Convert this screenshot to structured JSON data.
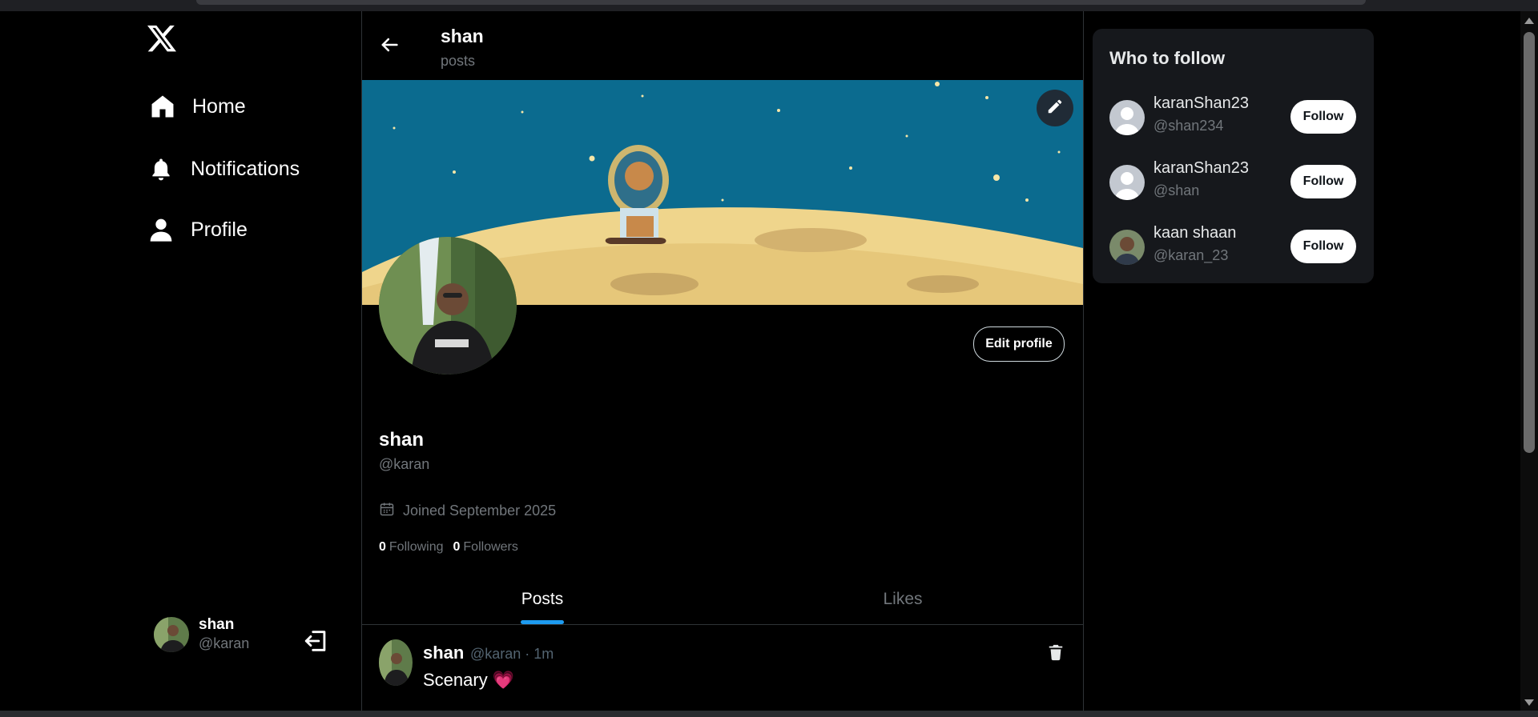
{
  "sidebar": {
    "nav": [
      {
        "label": "Home",
        "icon": "home-icon"
      },
      {
        "label": "Notifications",
        "icon": "bell-icon"
      },
      {
        "label": "Profile",
        "icon": "user-icon"
      }
    ],
    "account": {
      "name": "shan",
      "handle": "@karan"
    }
  },
  "header": {
    "name": "shan",
    "subtitle": "posts"
  },
  "profile": {
    "name": "shan",
    "handle": "@karan",
    "joined": "Joined September 2025",
    "following_count": "0",
    "following_label": "Following",
    "followers_count": "0",
    "followers_label": "Followers",
    "edit_label": "Edit profile"
  },
  "tabs": [
    {
      "label": "Posts",
      "active": true
    },
    {
      "label": "Likes",
      "active": false
    }
  ],
  "post": {
    "name": "shan",
    "meta": "@karan · 1m",
    "text": "Scenary 💗"
  },
  "who_to_follow": {
    "title": "Who to follow",
    "users": [
      {
        "name": "karanShan23",
        "handle": "@shan234",
        "button": "Follow"
      },
      {
        "name": "karanShan23",
        "handle": "@shan",
        "button": "Follow"
      },
      {
        "name": "kaan shaan",
        "handle": "@karan_23",
        "button": "Follow"
      }
    ]
  },
  "colors": {
    "accent": "#1d9bf0",
    "background": "#000000",
    "card": "#16181c",
    "muted": "#71767b"
  }
}
